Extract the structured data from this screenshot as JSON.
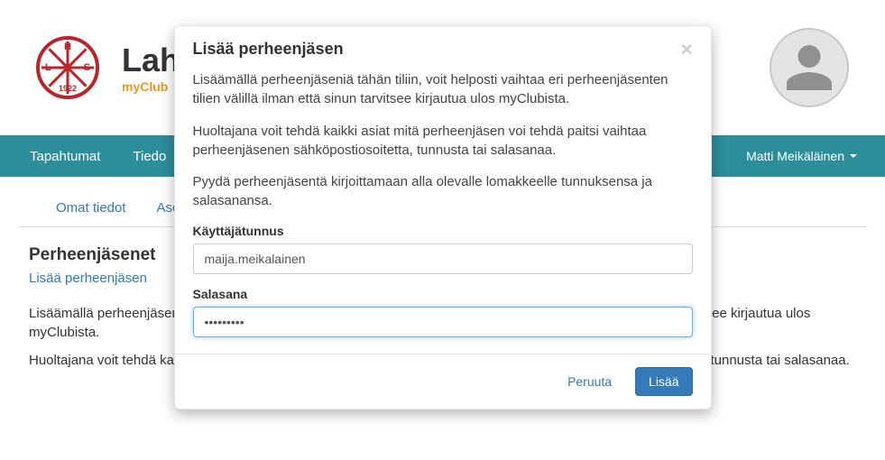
{
  "header": {
    "logo": {
      "letter_top": "H",
      "letter_left": "L",
      "letter_right": "S",
      "year": "1922"
    },
    "title_visible_prefix": "Lah",
    "subtitle": "myClub"
  },
  "nav": {
    "items": [
      "Tapahtumat",
      "Tiedo"
    ],
    "user": "Matti Meikäläinen"
  },
  "subnav": {
    "items": [
      "Omat tiedot",
      "Asetuk"
    ]
  },
  "content": {
    "heading": "Perheenjäsenet",
    "add_link": "Lisää perheenjäsen",
    "p1": "Lisäämällä perheenjäseniä tähän tiliin, voit helposti vaihtaa eri perheenjäsenten tilien välillä ilman että sinun tarvitsee kirjautua ulos myClubista.",
    "p2": "Huoltajana voit tehdä kaikki asiat mitä perheenjäsen voi tehdä paitsi vaihtaa perheenjäsenen sähköpostiosoitetta, tunnusta tai salasanaa."
  },
  "modal": {
    "title": "Lisää perheenjäsen",
    "close": "×",
    "p1": "Lisäämällä perheenjäseniä tähän tiliin, voit helposti vaihtaa eri perheenjäsenten tilien välillä ilman että sinun tarvitsee kirjautua ulos myClubista.",
    "p2": "Huoltajana voit tehdä kaikki asiat mitä perheenjäsen voi tehdä paitsi vaihtaa perheenjäsenen sähköpostiosoitetta, tunnusta tai salasanaa.",
    "p3": "Pyydä perheenjäsentä kirjoittamaan alla olevalle lomakkeelle tunnuksensa ja salasanansa.",
    "username_label": "Käyttäjätunnus",
    "username_value": "maija.meikalainen",
    "password_label": "Salasana",
    "password_value": "•••••••••",
    "cancel": "Peruuta",
    "submit": "Lisää"
  }
}
